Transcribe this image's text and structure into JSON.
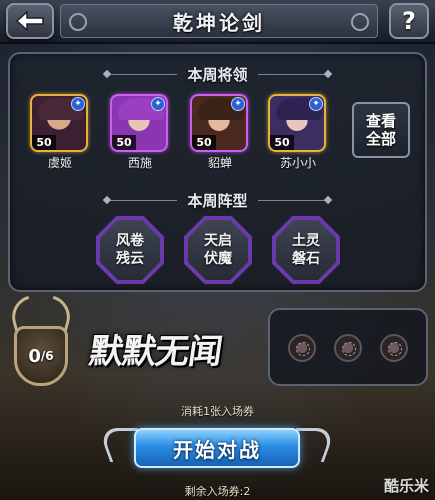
{
  "header": {
    "title": "乾坤论剑",
    "help_label": "?"
  },
  "weekly_heroes": {
    "title": "本周将领",
    "view_all_label": "查看全部",
    "heroes": [
      {
        "name": "虞姬",
        "level": "50",
        "badge": "✦"
      },
      {
        "name": "西施",
        "level": "50",
        "badge": "✦"
      },
      {
        "name": "貂蝉",
        "level": "50",
        "badge": "✦"
      },
      {
        "name": "苏小小",
        "level": "50",
        "badge": "✦"
      }
    ]
  },
  "weekly_formations": {
    "title": "本周阵型",
    "items": [
      {
        "name": "风卷残云"
      },
      {
        "name": "天启伏魔"
      },
      {
        "name": "土灵磐石"
      }
    ]
  },
  "progress": {
    "current": "0",
    "total": "/6"
  },
  "mode_name": "默默无闻",
  "cost_text": "消耗1张入场券",
  "start_button_label": "开始对战",
  "remaining_text": "剩余入场券:2",
  "watermark": "酷乐米",
  "colors": {
    "hero_gold_border": "#e8b33a",
    "hero_purple_border": "#d05cf2",
    "formation_border": "#6a3aa8",
    "start_button": "#2a8de3"
  }
}
